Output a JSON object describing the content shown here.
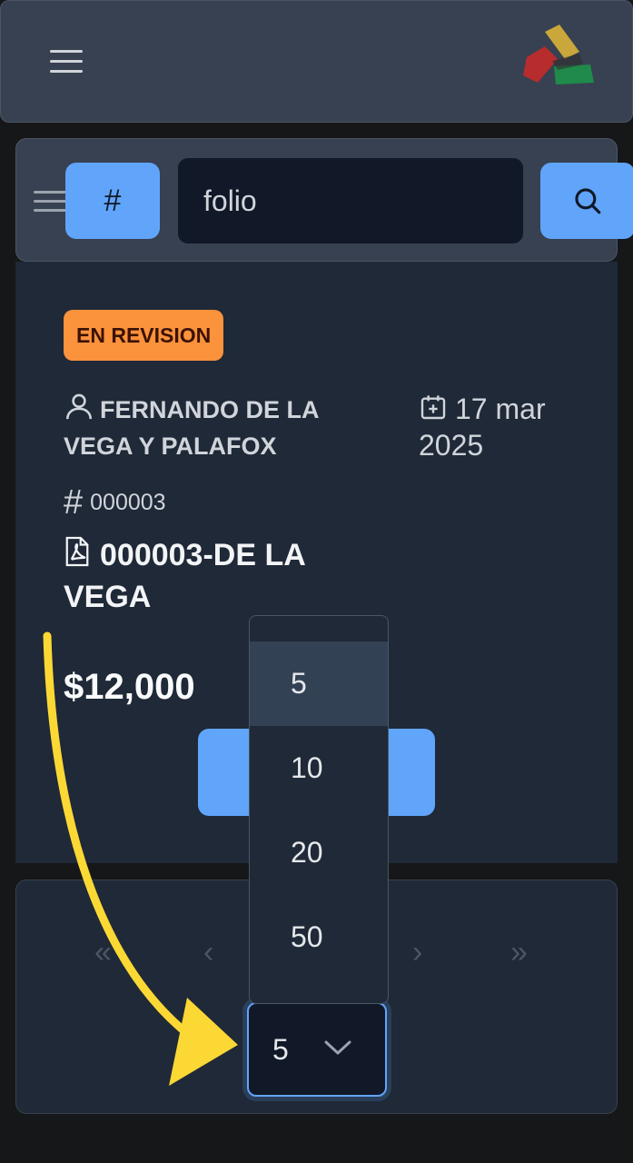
{
  "header": {
    "menu_icon": "hamburger-icon",
    "logo_icon": "app-logo"
  },
  "search": {
    "filter_icon": "hash-icon",
    "filter_label": "#",
    "placeholder": "folio",
    "search_icon": "search-icon"
  },
  "record": {
    "status": "EN REVISION",
    "status_color": "#fb923c",
    "person": "FERNANDO DE LA VEGA Y PALAFOX",
    "date": "17 mar 2025",
    "folio": "000003",
    "document": "000003-DE LA VEGA",
    "amount": "$12,000"
  },
  "pagination": {
    "first": "«",
    "prev": "‹",
    "next": "›",
    "last": "»",
    "page_size": "5",
    "page_size_options": [
      "5",
      "10",
      "20",
      "50"
    ]
  },
  "colors": {
    "accent": "#60a5fa",
    "panel": "#1f2937",
    "header": "#374151",
    "annotation_arrow": "#fcd835"
  }
}
